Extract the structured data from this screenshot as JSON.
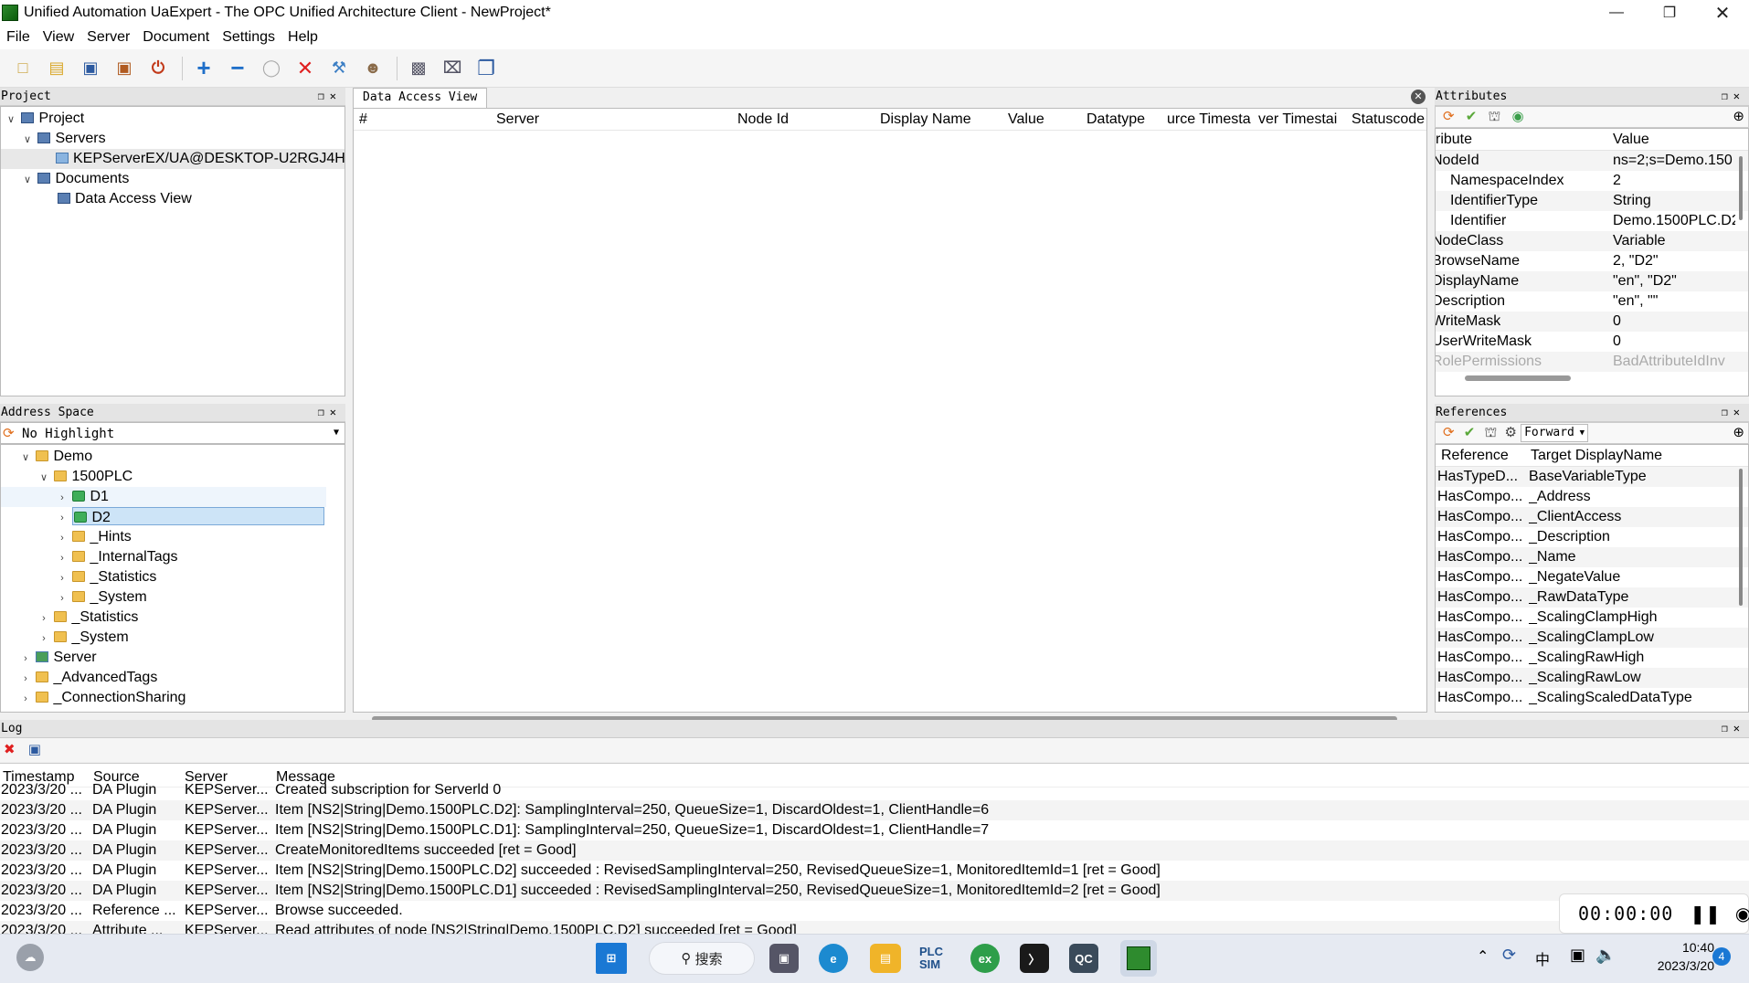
{
  "window": {
    "title": "Unified Automation UaExpert - The OPC Unified Architecture Client - NewProject*"
  },
  "menu": [
    "File",
    "View",
    "Server",
    "Document",
    "Settings",
    "Help"
  ],
  "project": {
    "header": "Project",
    "items": [
      {
        "label": "Project"
      },
      {
        "label": "Servers"
      },
      {
        "label": "KEPServerEX/UA@DESKTOP-U2RGJ4H"
      },
      {
        "label": "Documents"
      },
      {
        "label": "Data Access View"
      }
    ]
  },
  "address_space": {
    "header": "Address Space",
    "highlight": "No Highlight",
    "items": [
      {
        "label": "Demo"
      },
      {
        "label": "1500PLC"
      },
      {
        "label": "D1"
      },
      {
        "label": "D2"
      },
      {
        "label": "_Hints"
      },
      {
        "label": "_InternalTags"
      },
      {
        "label": "_Statistics"
      },
      {
        "label": "_System"
      },
      {
        "label": "_Statistics"
      },
      {
        "label": "_System"
      },
      {
        "label": "Server"
      },
      {
        "label": "_AdvancedTags"
      },
      {
        "label": "_ConnectionSharing"
      }
    ]
  },
  "dav": {
    "tab": "Data Access View",
    "columns": [
      "#",
      "Server",
      "Node Id",
      "Display Name",
      "Value",
      "Datatype",
      "urce Timesta",
      "ver Timestai",
      "Statuscode"
    ]
  },
  "attributes": {
    "header": "Attributes",
    "col_attr": "ribute",
    "col_value": "Value",
    "rows": [
      {
        "name": "NodeId",
        "value": "ns=2;s=Demo.150"
      },
      {
        "name": "NamespaceIndex",
        "value": "2"
      },
      {
        "name": "IdentifierType",
        "value": "String"
      },
      {
        "name": "Identifier",
        "value": "Demo.1500PLC.D2"
      },
      {
        "name": "NodeClass",
        "value": "Variable"
      },
      {
        "name": "BrowseName",
        "value": "2, \"D2\""
      },
      {
        "name": "DisplayName",
        "value": "\"en\", \"D2\""
      },
      {
        "name": "Description",
        "value": "\"en\", \"\""
      },
      {
        "name": "WriteMask",
        "value": "0"
      },
      {
        "name": "UserWriteMask",
        "value": "0"
      },
      {
        "name": "RolePermissions",
        "value": "BadAttributeIdInv"
      }
    ]
  },
  "references": {
    "header": "References",
    "direction": "Forward",
    "col_ref": "Reference",
    "col_target": "Target DisplayName",
    "rows": [
      {
        "ref": "HasTypeD...",
        "target": "BaseVariableType"
      },
      {
        "ref": "HasCompo...",
        "target": "_Address"
      },
      {
        "ref": "HasCompo...",
        "target": "_ClientAccess"
      },
      {
        "ref": "HasCompo...",
        "target": "_Description"
      },
      {
        "ref": "HasCompo...",
        "target": "_Name"
      },
      {
        "ref": "HasCompo...",
        "target": "_NegateValue"
      },
      {
        "ref": "HasCompo...",
        "target": "_RawDataType"
      },
      {
        "ref": "HasCompo...",
        "target": "_ScalingClampHigh"
      },
      {
        "ref": "HasCompo...",
        "target": "_ScalingClampLow"
      },
      {
        "ref": "HasCompo...",
        "target": "_ScalingRawHigh"
      },
      {
        "ref": "HasCompo...",
        "target": "_ScalingRawLow"
      },
      {
        "ref": "HasCompo...",
        "target": "_ScalingScaledDataType"
      }
    ]
  },
  "log": {
    "header": "Log",
    "columns": [
      "Timestamp",
      "Source",
      "Server",
      "Message"
    ],
    "rows": [
      {
        "ts": "2023/3/20 ...",
        "src": "DA Plugin",
        "srv": "KEPServer...",
        "msg": "Created subscription for Serverld 0"
      },
      {
        "ts": "2023/3/20 ...",
        "src": "DA Plugin",
        "srv": "KEPServer...",
        "msg": "Item [NS2|String|Demo.1500PLC.D2]: SamplingInterval=250, QueueSize=1, DiscardOldest=1, ClientHandle=6"
      },
      {
        "ts": "2023/3/20 ...",
        "src": "DA Plugin",
        "srv": "KEPServer...",
        "msg": "Item [NS2|String|Demo.1500PLC.D1]: SamplingInterval=250, QueueSize=1, DiscardOldest=1, ClientHandle=7"
      },
      {
        "ts": "2023/3/20 ...",
        "src": "DA Plugin",
        "srv": "KEPServer...",
        "msg": "CreateMonitoredItems succeeded [ret = Good]"
      },
      {
        "ts": "2023/3/20 ...",
        "src": "DA Plugin",
        "srv": "KEPServer...",
        "msg": "Item [NS2|String|Demo.1500PLC.D2] succeeded : RevisedSamplingInterval=250, RevisedQueueSize=1, MonitoredItemId=1 [ret = Good]"
      },
      {
        "ts": "2023/3/20 ...",
        "src": "DA Plugin",
        "srv": "KEPServer...",
        "msg": "Item [NS2|String|Demo.1500PLC.D1] succeeded : RevisedSamplingInterval=250, RevisedQueueSize=1, MonitoredItemId=2 [ret = Good]"
      },
      {
        "ts": "2023/3/20 ...",
        "src": "Reference ...",
        "srv": "KEPServer...",
        "msg": "Browse succeeded."
      },
      {
        "ts": "2023/3/20 ...",
        "src": "Attribute ...",
        "srv": "KEPServer...",
        "msg": "Read attributes of node [NS2|String|Demo.1500PLC.D2] succeeded [ret = Good]"
      }
    ]
  },
  "recorder": {
    "time": "00:00:00"
  },
  "taskbar": {
    "search": "搜索",
    "plcsim": "PLC SIM",
    "ime": "中",
    "time": "10:40",
    "date": "2023/3/20",
    "badge": "4"
  }
}
